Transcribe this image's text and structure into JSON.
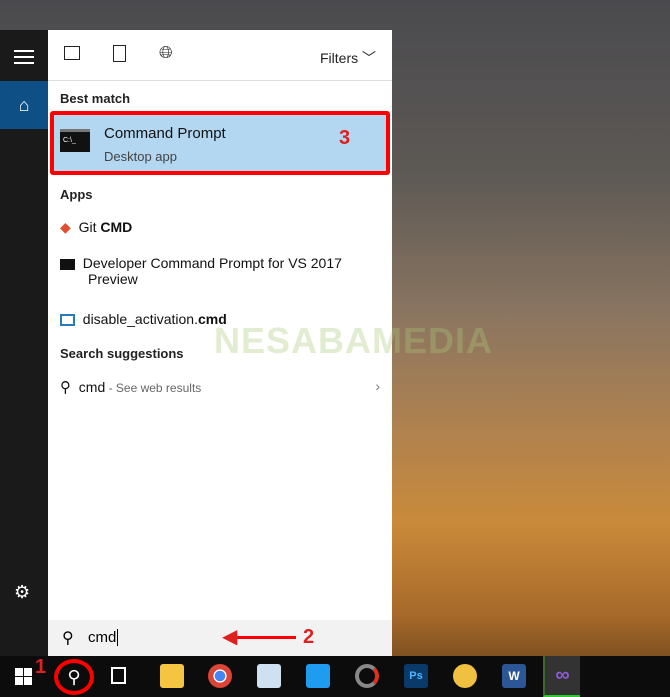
{
  "top_bar": {
    "icons": [
      "apps-filter-icon",
      "documents-filter-icon",
      "web-filter-icon"
    ],
    "filters_label": "Filters"
  },
  "rail": {
    "icons": [
      "hamburger-menu-icon",
      "home-icon",
      "settings-gear-icon"
    ]
  },
  "best_match": {
    "header": "Best match",
    "title": "Command Prompt",
    "subtitle": "Desktop app",
    "annotation": "3"
  },
  "apps": {
    "header": "Apps",
    "items": [
      {
        "prefix": "Git ",
        "bold": "CMD",
        "icon": "git-icon"
      },
      {
        "prefix": "Developer Command Prompt for VS 2017",
        "line2": "Preview",
        "icon": "console-icon"
      },
      {
        "prefix": "disable_activation.",
        "bold": "cmd",
        "icon": "monitor-icon"
      }
    ]
  },
  "suggestions": {
    "header": "Search suggestions",
    "query": "cmd",
    "suffix": " - See web results"
  },
  "search_box": {
    "value": "cmd",
    "annotation": "2"
  },
  "taskbar": {
    "annotation": "1",
    "apps": [
      "file-explorer",
      "chrome",
      "wordpad",
      "shareit",
      "davinci",
      "photoshop",
      "paint",
      "word",
      "visual-studio"
    ]
  },
  "watermark": "NESABAMEDIA",
  "colors": {
    "highlight": "#b3d7f0",
    "annotation": "#ff0000",
    "home_active": "#0e4f86"
  }
}
